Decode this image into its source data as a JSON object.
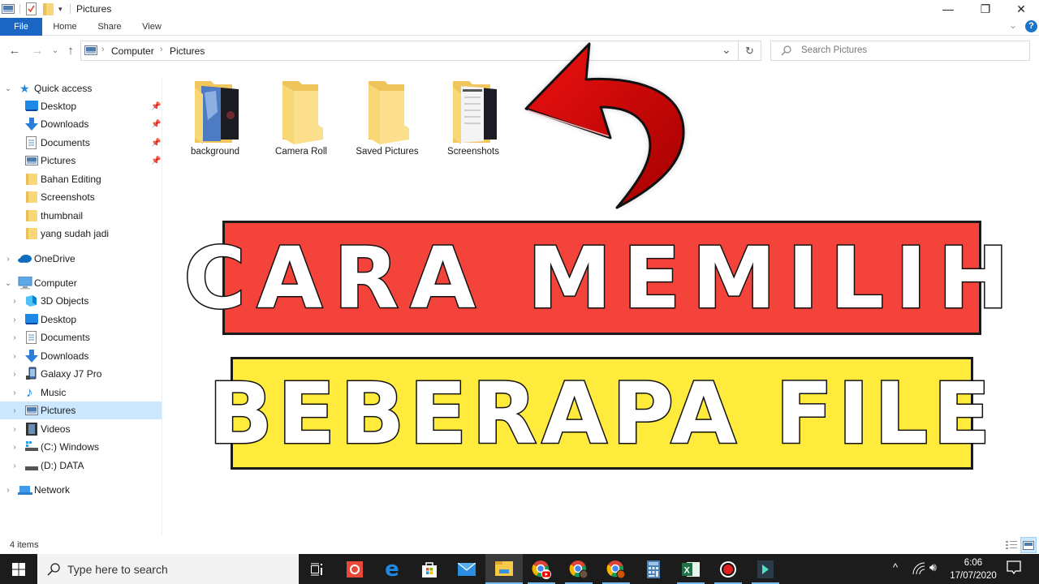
{
  "window": {
    "title": "Pictures",
    "controls": {
      "minimize": "—",
      "restore": "❐",
      "close": "✕"
    }
  },
  "ribbon": {
    "tabs": [
      {
        "label": "File",
        "active": true
      },
      {
        "label": "Home"
      },
      {
        "label": "Share"
      },
      {
        "label": "View"
      }
    ],
    "expand_icon": "chevron-down",
    "help_icon": "?"
  },
  "navigation": {
    "back": "←",
    "forward": "→",
    "recent": "⌄",
    "up": "↑",
    "breadcrumb": [
      "Computer",
      "Pictures"
    ],
    "dropdown": "⌄",
    "refresh": "↻",
    "search_placeholder": "Search Pictures"
  },
  "sidebar": {
    "quick_access": {
      "label": "Quick access",
      "items": [
        {
          "label": "Desktop",
          "icon": "desktop-icon",
          "pinned": true
        },
        {
          "label": "Downloads",
          "icon": "download-icon",
          "pinned": true
        },
        {
          "label": "Documents",
          "icon": "documents-icon",
          "pinned": true
        },
        {
          "label": "Pictures",
          "icon": "pictures-icon",
          "pinned": true
        },
        {
          "label": "Bahan Editing",
          "icon": "folder-icon"
        },
        {
          "label": "Screenshots",
          "icon": "folder-icon"
        },
        {
          "label": "thumbnail",
          "icon": "folder-icon"
        },
        {
          "label": "yang sudah jadi",
          "icon": "folder-icon"
        }
      ]
    },
    "onedrive": {
      "label": "OneDrive"
    },
    "computer": {
      "label": "Computer",
      "items": [
        {
          "label": "3D Objects",
          "icon": "3d-objects-icon"
        },
        {
          "label": "Desktop",
          "icon": "desktop-icon"
        },
        {
          "label": "Documents",
          "icon": "documents-icon"
        },
        {
          "label": "Downloads",
          "icon": "download-icon"
        },
        {
          "label": "Galaxy J7 Pro",
          "icon": "phone-icon"
        },
        {
          "label": "Music",
          "icon": "music-icon"
        },
        {
          "label": "Pictures",
          "icon": "pictures-icon",
          "selected": true
        },
        {
          "label": "Videos",
          "icon": "videos-icon"
        },
        {
          "label": "(C:) Windows",
          "icon": "windows-drive-icon"
        },
        {
          "label": "(D:) DATA",
          "icon": "drive-icon"
        }
      ]
    },
    "network": {
      "label": "Network"
    }
  },
  "content": {
    "folders": [
      {
        "label": "background",
        "preview": "image"
      },
      {
        "label": "Camera Roll",
        "preview": "none"
      },
      {
        "label": "Saved Pictures",
        "preview": "none"
      },
      {
        "label": "Screenshots",
        "preview": "image"
      }
    ],
    "overlay": {
      "line1": "CARA MEMILIH",
      "line2": "BEBERAPA FILE",
      "line1_bg": "#f4433b",
      "line2_bg": "#ffeb3b",
      "arrow_color": "#cc0000"
    }
  },
  "status": {
    "item_count": "4 items"
  },
  "taskbar": {
    "search_placeholder": "Type here to search",
    "apps": [
      "task-view",
      "office",
      "edge",
      "store",
      "mail",
      "file-explorer",
      "chrome-youtube",
      "chrome-profile-s",
      "chrome-profile-a",
      "calculator",
      "excel",
      "recorder",
      "filmora"
    ],
    "clock": {
      "time": "6:06",
      "date": "17/07/2020"
    }
  }
}
